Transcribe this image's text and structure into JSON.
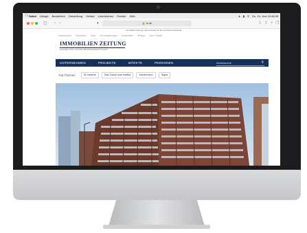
{
  "menubar": {
    "apple_icon": "apple-icon",
    "items": [
      "Safari",
      "Ablage",
      "Bearbeiten",
      "Darstellung",
      "Verlauf",
      "Lesezeichen",
      "Fenster",
      "Hilfe"
    ],
    "datetime": "Do. 15. Juni 15:48:38"
  },
  "browser": {
    "url": "iz.de",
    "traffic_lights": [
      "#ff5f57",
      "#febc2e",
      "#28c840"
    ]
  },
  "site": {
    "banner": "Immobilien Zeitung | Fachzeitung für die Immobilienwirtschaft",
    "topnav": [
      "Nachrichten",
      "Research",
      "Jobs",
      "Veranstaltungen",
      "Newsletter",
      "ePaper",
      "Abo-Pakete"
    ],
    "logo": {
      "name": "IMMOBILIEN ZEITUNG",
      "tagline": "FACHZEITUNG FÜR DIE IMMOBILIENWIRTSCHAFT"
    },
    "mainnav": [
      "UNTERNEHMEN",
      "PROJEKTE",
      "MÄRKTE",
      "PERSONEN"
    ],
    "search_placeholder": "Archivsuche",
    "topics_label": "Top-Themen",
    "topics": [
      "ID Institute",
      "Das Game zum Institut",
      "Insolvenzen",
      "Signa"
    ]
  },
  "colors": {
    "navy": "#16305a",
    "sky": "#b9d0e6",
    "brick": "#6a3a2c"
  }
}
